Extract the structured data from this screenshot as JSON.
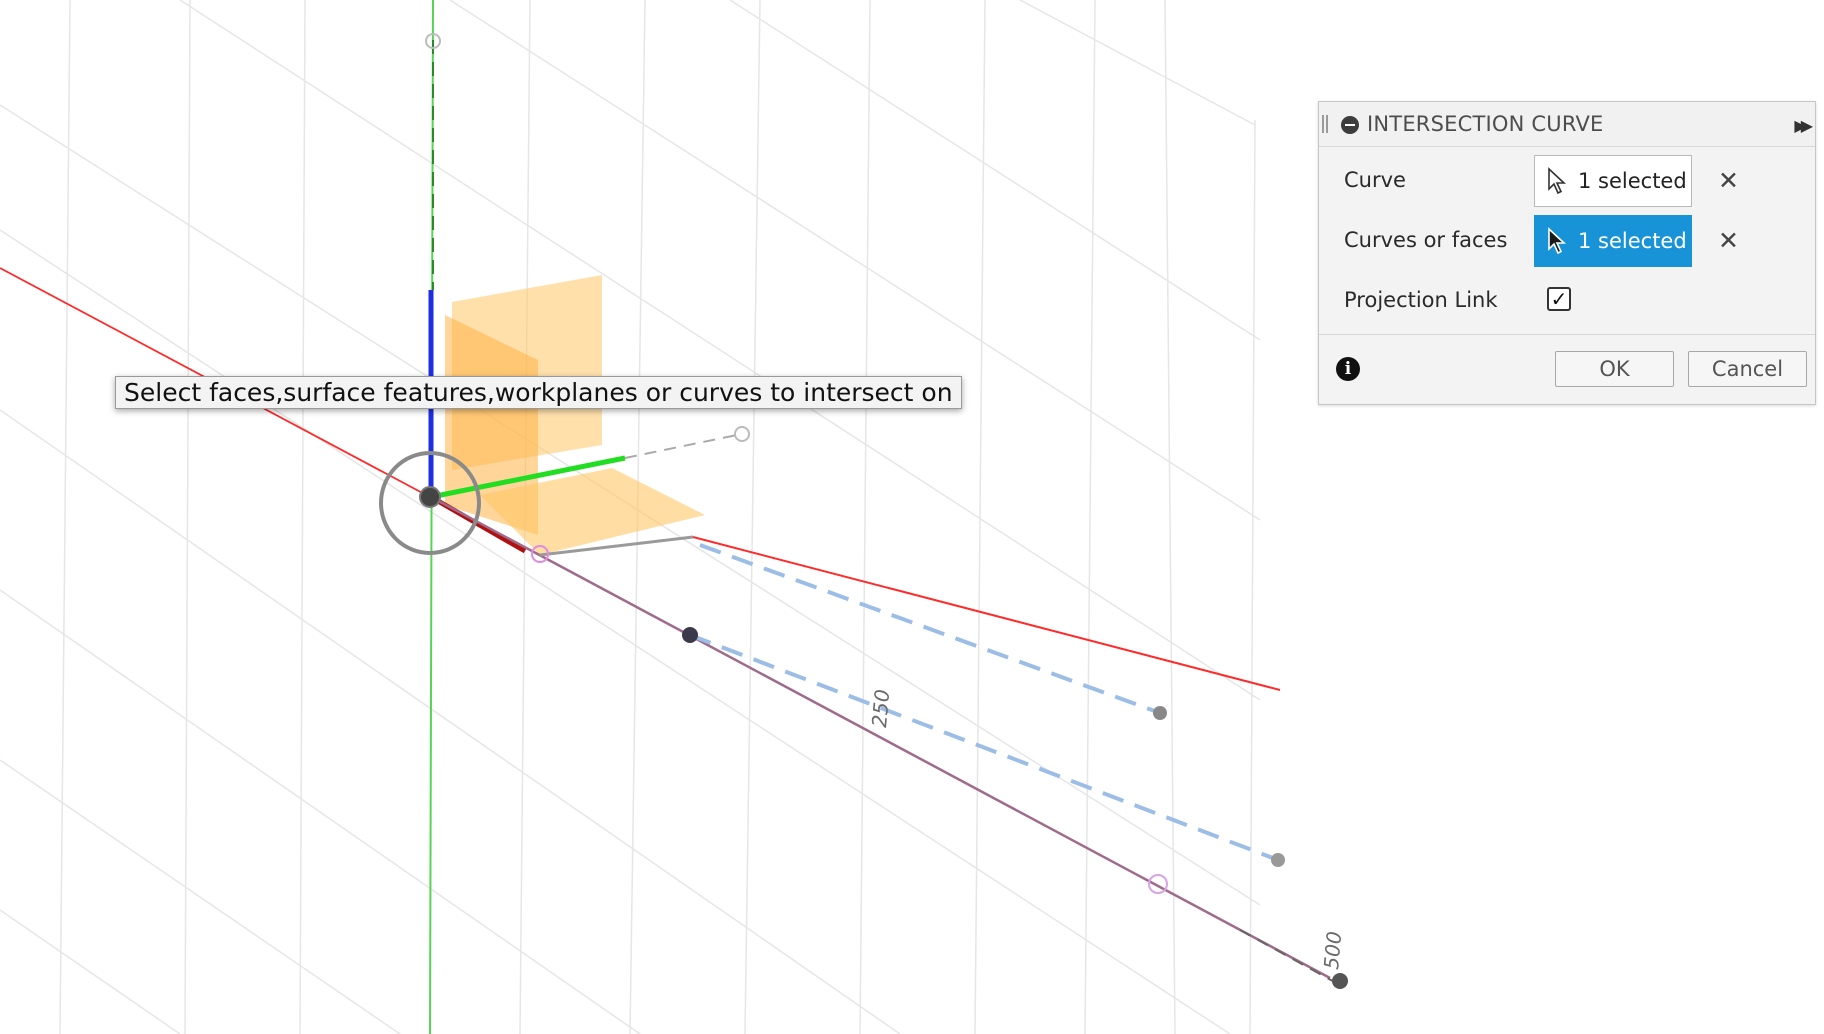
{
  "viewport": {
    "dimension_labels": [
      "250",
      "500"
    ]
  },
  "tooltip": {
    "text": "Select faces,surface features,workplanes or curves to intersect on"
  },
  "dialog": {
    "title": "INTERSECTION CURVE",
    "rows": [
      {
        "label": "Curve",
        "value": "1 selected",
        "active": false
      },
      {
        "label": "Curves or faces",
        "value": "1 selected",
        "active": true
      },
      {
        "label": "Projection Link",
        "checked": true
      }
    ],
    "ok_label": "OK",
    "cancel_label": "Cancel"
  },
  "icons": {
    "collapse": "minus-circle-icon",
    "expand": "double-arrow-right-icon",
    "clear": "close-icon",
    "select": "cursor-arrow-icon",
    "info": "info-icon",
    "check": "checkmark-icon"
  },
  "colors": {
    "active_selection": "#1993d8",
    "x_axis": "#e02020",
    "y_axis": "#22cc22",
    "z_axis": "#1f2ee0",
    "plane": "#ffc766",
    "dashed_lines": "#9cbde6"
  }
}
